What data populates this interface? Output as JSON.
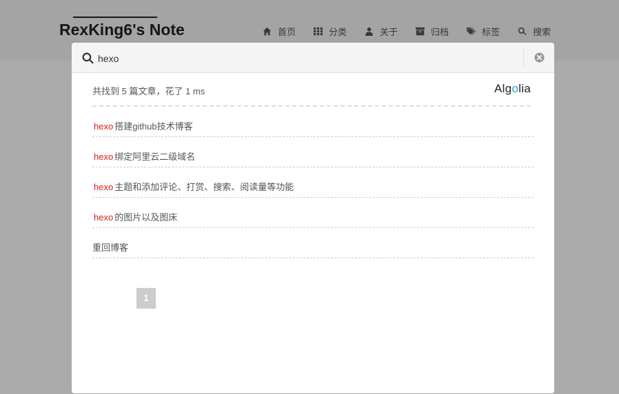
{
  "site": {
    "brand": "RexKing6's Note",
    "nav": [
      {
        "label": "首页",
        "icon": "home-icon"
      },
      {
        "label": "分类",
        "icon": "grid-icon"
      },
      {
        "label": "关于",
        "icon": "user-icon"
      },
      {
        "label": "归档",
        "icon": "archive-icon"
      },
      {
        "label": "标签",
        "icon": "tags-icon"
      },
      {
        "label": "搜索",
        "icon": "search-icon"
      }
    ]
  },
  "search": {
    "query": "hexo",
    "stats": "共找到 5 篇文章，花了 1 ms",
    "provider_prefix": "Alg",
    "provider_mark": "o",
    "provider_suffix": "lia",
    "results": [
      {
        "highlight": "hexo",
        "rest": "搭建github技术博客"
      },
      {
        "highlight": "hexo",
        "rest": "绑定阿里云二级域名"
      },
      {
        "highlight": "hexo",
        "rest": "主题和添加评论、打赏、搜索、阅读量等功能"
      },
      {
        "highlight": "hexo",
        "rest": "的图片以及图床"
      },
      {
        "highlight": "",
        "rest": "重回博客"
      }
    ],
    "current_page": "1"
  },
  "colors": {
    "highlight": "#e02222",
    "accent": "#2d9bd1",
    "overlay": "rgba(0,0,0,0.33)"
  }
}
